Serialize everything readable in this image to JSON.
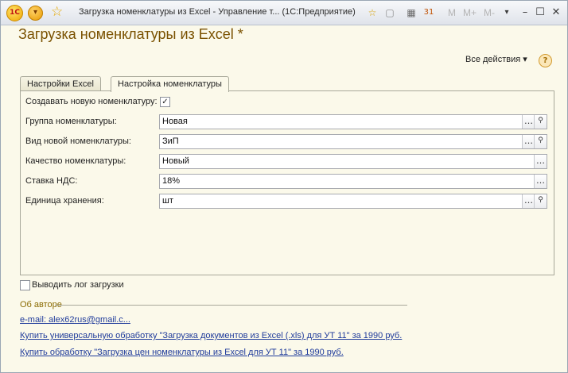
{
  "window": {
    "title": "Загрузка номенклатуры из Excel - Управление т... (1С:Предприятие)",
    "logo": "1С",
    "toolbar": {
      "m": "M",
      "m_plus": "M+",
      "m_minus": "M-"
    }
  },
  "form": {
    "title": "Загрузка номенклатуры из Excel *",
    "all_actions": "Все действия ▾",
    "help": "?"
  },
  "tabs": [
    {
      "label": "Настройки Excel",
      "active": false
    },
    {
      "label": "Настройка номенклатуры",
      "active": true
    }
  ],
  "settings": {
    "create_new_label": "Создавать новую номенклатуру:",
    "create_new_checked": true,
    "fields": [
      {
        "label": "Группа номенклатуры:",
        "value": "Новая",
        "has_search": true
      },
      {
        "label": "Вид новой номенклатуры:",
        "value": "ЗиП",
        "has_search": true
      },
      {
        "label": "Качество номенклатуры:",
        "value": "Новый",
        "has_search": false
      },
      {
        "label": "Ставка НДС:",
        "value": "18%",
        "has_search": false
      },
      {
        "label": "Единица хранения:",
        "value": "шт",
        "has_search": true
      }
    ]
  },
  "log": {
    "label": "Выводить лог загрузки",
    "checked": false
  },
  "about": {
    "header": "Об авторе",
    "links": [
      "e-mail: alex62rus@gmail.c...",
      "Купить универсальную обработку \"Загрузка документов из Excel (.xls) для УТ 11\" за 1990 руб.",
      "Купить обработку \"Загрузка цен номенклатуры из Excel для УТ 11\" за 1990 руб."
    ]
  },
  "icons": {
    "select": "…",
    "search": "🔍"
  },
  "colors": {
    "title": "#7a5100",
    "link": "#1f3b9b",
    "background": "#fbf9ea"
  }
}
